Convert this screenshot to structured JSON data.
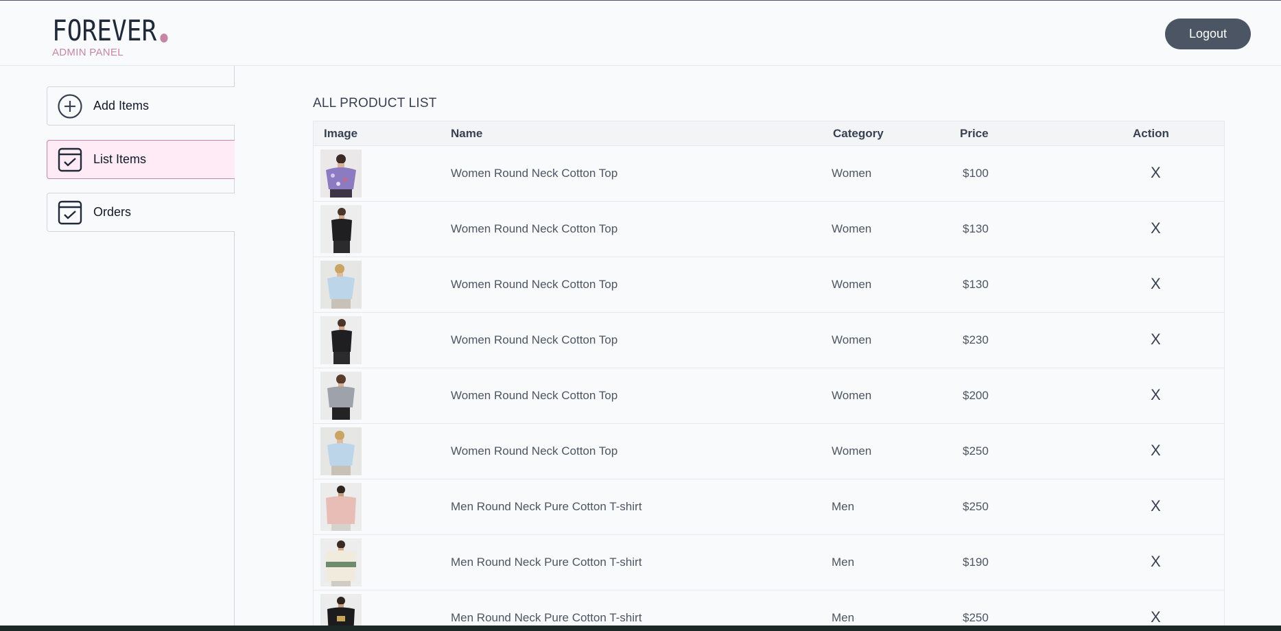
{
  "brand": {
    "logo_text": "FOREVER",
    "subtitle": "ADMIN PANEL",
    "accent_color": "#c586a5"
  },
  "header": {
    "logout_label": "Logout"
  },
  "sidebar": {
    "items": [
      {
        "label": "Add Items",
        "icon": "plus-circle-icon",
        "active": false
      },
      {
        "label": "List Items",
        "icon": "checklist-icon",
        "active": true
      },
      {
        "label": "Orders",
        "icon": "checklist-icon",
        "active": false
      }
    ]
  },
  "main": {
    "title": "ALL PRODUCT LIST",
    "columns": [
      "Image",
      "Name",
      "Category",
      "Price",
      "Action"
    ],
    "rows": [
      {
        "name": "Women Round Neck Cotton Top",
        "category": "Women",
        "price": "$100",
        "action": "X",
        "thumb": "floral-top"
      },
      {
        "name": "Women Round Neck Cotton Top",
        "category": "Women",
        "price": "$130",
        "action": "X",
        "thumb": "black-tee"
      },
      {
        "name": "Women Round Neck Cotton Top",
        "category": "Women",
        "price": "$130",
        "action": "X",
        "thumb": "blue-shirt"
      },
      {
        "name": "Women Round Neck Cotton Top",
        "category": "Women",
        "price": "$230",
        "action": "X",
        "thumb": "black-tee"
      },
      {
        "name": "Women Round Neck Cotton Top",
        "category": "Women",
        "price": "$200",
        "action": "X",
        "thumb": "grey-tee"
      },
      {
        "name": "Women Round Neck Cotton Top",
        "category": "Women",
        "price": "$250",
        "action": "X",
        "thumb": "blue-shirt"
      },
      {
        "name": "Men Round Neck Pure Cotton T-shirt",
        "category": "Men",
        "price": "$250",
        "action": "X",
        "thumb": "pink-shirt"
      },
      {
        "name": "Men Round Neck Pure Cotton T-shirt",
        "category": "Men",
        "price": "$190",
        "action": "X",
        "thumb": "striped-sweater"
      },
      {
        "name": "Men Round Neck Pure Cotton T-shirt",
        "category": "Men",
        "price": "$250",
        "action": "X",
        "thumb": "black-tee-men"
      }
    ]
  }
}
